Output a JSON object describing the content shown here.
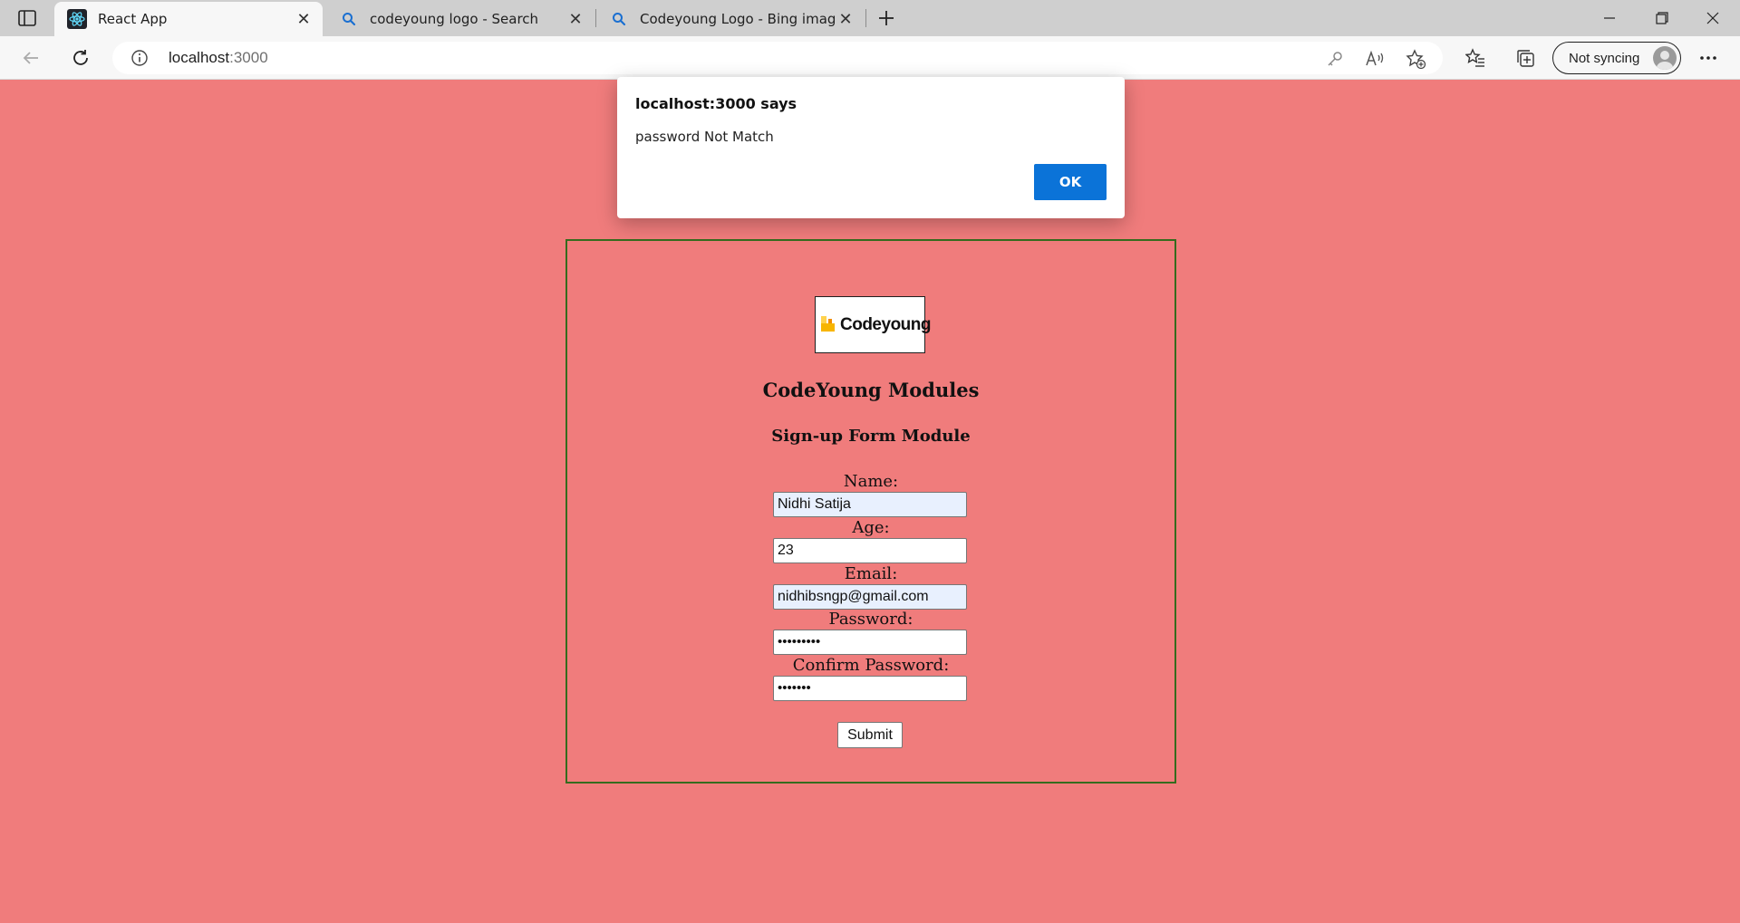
{
  "browser": {
    "tabs": [
      {
        "title": "React App",
        "icon": "react-icon",
        "active": true
      },
      {
        "title": "codeyoung logo - Search",
        "icon": "search-icon",
        "active": false
      },
      {
        "title": "Codeyoung Logo - Bing images",
        "icon": "search-icon",
        "active": false
      }
    ],
    "address": {
      "host": "localhost",
      "port": ":3000"
    },
    "sync_label": "Not syncing",
    "accent_color": "#0b73d8"
  },
  "page": {
    "background_color": "#f07c7c",
    "logo_text": "Codeyoung",
    "title": "CodeYoung Modules",
    "subtitle": "Sign-up Form Module",
    "form": {
      "name_label": "Name:",
      "name_value": "Nidhi Satija",
      "age_label": "Age:",
      "age_value": "23",
      "email_label": "Email:",
      "email_value": "nidhibsngp@gmail.com",
      "password_label": "Password:",
      "password_value": "•••••••••",
      "confirm_label": "Confirm Password:",
      "confirm_value": "•••••••",
      "submit_label": "Submit"
    }
  },
  "dialog": {
    "title": "localhost:3000 says",
    "message": "password Not Match",
    "ok_label": "OK"
  }
}
